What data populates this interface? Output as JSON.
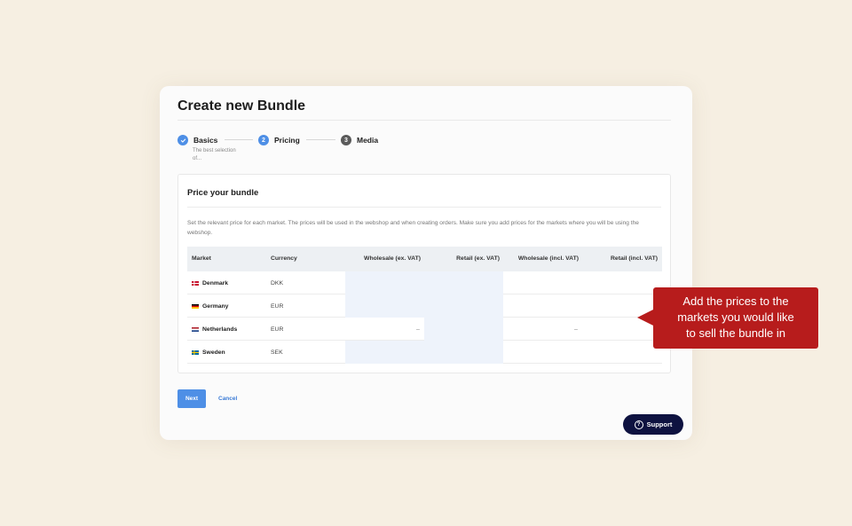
{
  "dialog": {
    "title": "Create new Bundle"
  },
  "stepper": {
    "steps": [
      {
        "label": "Basics",
        "state": "done",
        "sub": "The best selection of..."
      },
      {
        "label": "Pricing",
        "state": "active",
        "number": "2"
      },
      {
        "label": "Media",
        "state": "todo",
        "number": "3"
      }
    ]
  },
  "panel": {
    "title": "Price your bundle",
    "description": "Set the relevant price for each market. The prices will be used in the webshop and when creating orders. Make sure you add prices for the markets where you will be using the webshop."
  },
  "table": {
    "headers": [
      "Market",
      "Currency",
      "Wholesale (ex. VAT)",
      "Retail (ex. VAT)",
      "Wholesale (incl. VAT)",
      "Retail (incl. VAT)"
    ],
    "rows": [
      {
        "market": "Denmark",
        "currency": "DKK"
      },
      {
        "market": "Germany",
        "currency": "EUR"
      },
      {
        "market": "Netherlands",
        "currency": "EUR",
        "wholesale_ex": "–",
        "wholesale_incl": "–"
      },
      {
        "market": "Sweden",
        "currency": "SEK"
      }
    ]
  },
  "actions": {
    "next_label": "Next",
    "cancel_label": "Cancel"
  },
  "support": {
    "label": "Support",
    "icon": "question-circle-icon"
  },
  "callout": {
    "line1": "Add the prices to the",
    "line2": "markets you would like",
    "line3": "to sell the bundle in"
  },
  "colors": {
    "accent": "#4e8fe6",
    "callout": "#b71c1c",
    "support": "#0e1240",
    "background": "#f6efe2"
  }
}
